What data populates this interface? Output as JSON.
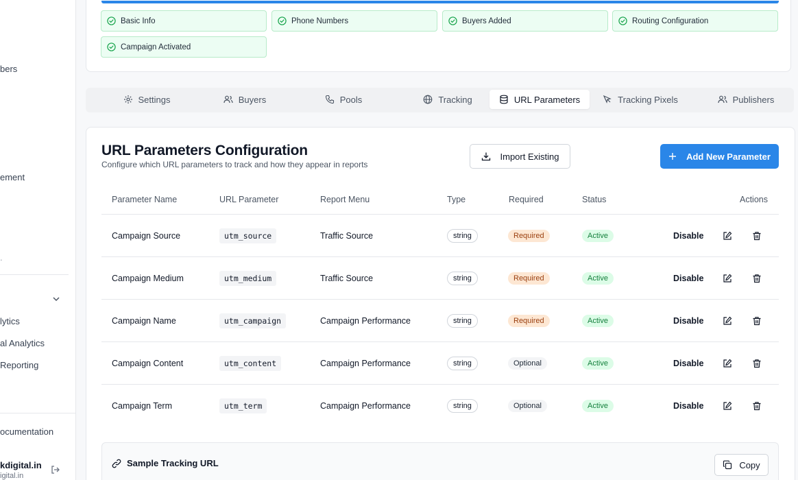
{
  "sidebar": {
    "items": [
      {
        "label": "bers"
      },
      {
        "label": "ement"
      },
      {
        "label": "."
      },
      {
        "label": "lytics"
      },
      {
        "label": "al Analytics"
      },
      {
        "label": " Reporting"
      },
      {
        "label": "ocumentation"
      }
    ],
    "user": {
      "name": "kdigital.in",
      "email": "igital.in"
    }
  },
  "steps": [
    {
      "label": "Basic Info"
    },
    {
      "label": "Phone Numbers"
    },
    {
      "label": "Buyers Added"
    },
    {
      "label": "Routing Configuration"
    },
    {
      "label": "Campaign Activated"
    }
  ],
  "tabs": [
    {
      "label": "Settings",
      "icon": "gear-icon"
    },
    {
      "label": "Buyers",
      "icon": "users-icon"
    },
    {
      "label": "Pools",
      "icon": "phone-icon"
    },
    {
      "label": "Tracking",
      "icon": "globe-icon"
    },
    {
      "label": "URL Parameters",
      "icon": "database-icon",
      "active": true
    },
    {
      "label": "Tracking Pixels",
      "icon": "cursor-icon"
    },
    {
      "label": "Publishers",
      "icon": "users-icon"
    }
  ],
  "page": {
    "title": "URL Parameters Configuration",
    "subtitle": "Configure which URL parameters to track and how they appear in reports",
    "import_label": "Import Existing",
    "add_label": "Add New Parameter"
  },
  "table": {
    "headers": [
      "Parameter Name",
      "URL Parameter",
      "Report Menu",
      "Type",
      "Required",
      "Status",
      "Actions"
    ],
    "rows": [
      {
        "name": "Campaign Source",
        "param": "utm_source",
        "menu": "Traffic Source",
        "type": "string",
        "required": "Required",
        "status": "Active",
        "action": "Disable"
      },
      {
        "name": "Campaign Medium",
        "param": "utm_medium",
        "menu": "Traffic Source",
        "type": "string",
        "required": "Required",
        "status": "Active",
        "action": "Disable"
      },
      {
        "name": "Campaign Name",
        "param": "utm_campaign",
        "menu": "Campaign Performance",
        "type": "string",
        "required": "Required",
        "status": "Active",
        "action": "Disable"
      },
      {
        "name": "Campaign Content",
        "param": "utm_content",
        "menu": "Campaign Performance",
        "type": "string",
        "required": "Optional",
        "status": "Active",
        "action": "Disable"
      },
      {
        "name": "Campaign Term",
        "param": "utm_term",
        "menu": "Campaign Performance",
        "type": "string",
        "required": "Optional",
        "status": "Active",
        "action": "Disable"
      }
    ]
  },
  "sample": {
    "title": "Sample Tracking URL",
    "copy_label": "Copy"
  },
  "colors": {
    "accent": "#2a86e8",
    "success": "#16a34a",
    "required_bg": "#fde7d3"
  }
}
